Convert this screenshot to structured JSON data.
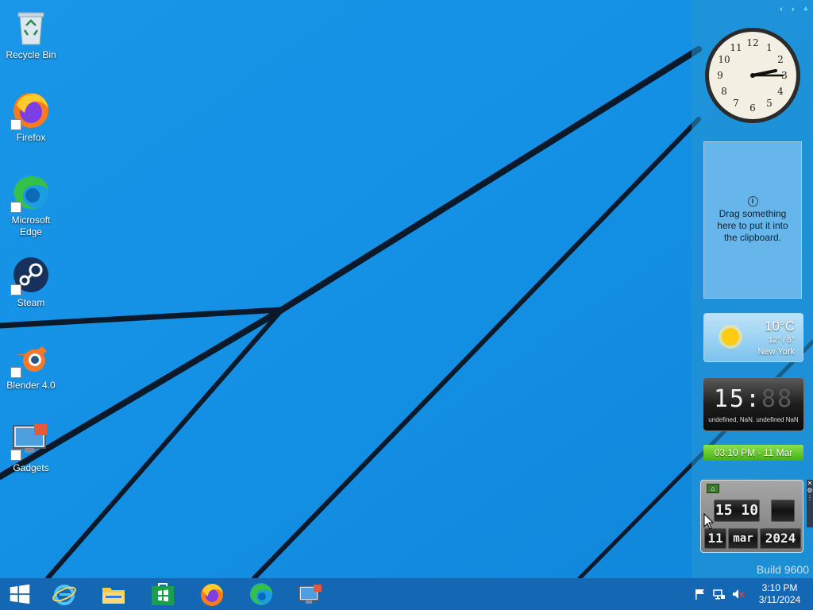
{
  "desktop": {
    "icons": [
      {
        "label": "Recycle Bin",
        "icon": "recycle-bin-icon"
      },
      {
        "label": "Firefox",
        "icon": "firefox-icon"
      },
      {
        "label": "Microsoft Edge",
        "icon": "edge-icon"
      },
      {
        "label": "Steam",
        "icon": "steam-icon"
      },
      {
        "label": "Blender 4.0",
        "icon": "blender-icon"
      },
      {
        "label": "Gadgets",
        "icon": "gadgets-icon"
      }
    ]
  },
  "sidebar": {
    "controls": [
      "‹",
      "›",
      "+"
    ],
    "clipboard": {
      "text": "Drag something here to put it into the clipboard.",
      "info": "i"
    },
    "weather": {
      "temp": "10°C",
      "range": "12° / 5°",
      "city": "New York"
    },
    "digital": {
      "hours": "15",
      "sep": ":",
      "minutes": "88",
      "subtitle": "undefined, NaN. undefined NaN"
    },
    "banner": {
      "text": "03:10 PM - 11 Mar"
    },
    "flip": {
      "hh": "15",
      "mm": "10",
      "day": "11",
      "month": "mar",
      "year": "2024"
    },
    "build": "Build 9600"
  },
  "taskbar": {
    "clock": {
      "time": "3:10 PM",
      "date": "3/11/2024"
    }
  },
  "colors": {
    "wallpaper": "#1a8fe0",
    "taskbar": "#1467b3",
    "banner": "#5cc81f"
  }
}
